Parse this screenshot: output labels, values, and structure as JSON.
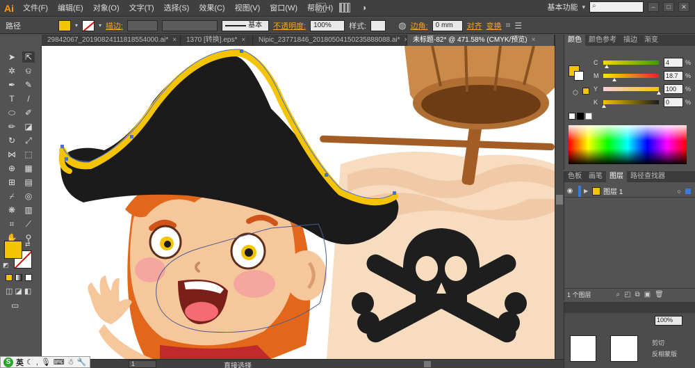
{
  "app": {
    "logo": "Ai"
  },
  "menu": [
    "文件(F)",
    "编辑(E)",
    "对象(O)",
    "文字(T)",
    "选择(S)",
    "效果(C)",
    "视图(V)",
    "窗口(W)",
    "帮助(H)"
  ],
  "menubar_right": {
    "workspace": "基本功能",
    "search_placeholder": ""
  },
  "control": {
    "selection_type": "路径",
    "fill_color": "#f5c400",
    "stroke_label": "描边:",
    "stroke_style": "基本",
    "opacity_label": "不透明度:",
    "opacity_value": "100%",
    "style_label": "样式:",
    "corner_label": "边角:",
    "corner_value": "0 mm",
    "align_label": "对齐",
    "transform_label": "变换"
  },
  "tabs": [
    {
      "label": "29842067_20190824111818554000.ai*",
      "active": false
    },
    {
      "label": "1370 [转换].eps*",
      "active": false
    },
    {
      "label": "Nipic_23771846_20180504150235888088.ai*",
      "active": false
    },
    {
      "label": "未标题-82* @ 471.58% (CMYK/预览)",
      "active": true
    }
  ],
  "color_panel": {
    "tabs": [
      "颜色",
      "颜色参考",
      "描边",
      "渐变"
    ],
    "channels": [
      {
        "label": "C",
        "value": "4",
        "level": 0.04
      },
      {
        "label": "M",
        "value": "18.7",
        "level": 0.187
      },
      {
        "label": "Y",
        "value": "100",
        "level": 1.0
      },
      {
        "label": "K",
        "value": "0",
        "level": 0.0
      }
    ],
    "pct": "%"
  },
  "layers_panel": {
    "tabs": [
      "色板",
      "画笔",
      "图层",
      "路径查找器"
    ],
    "layers": [
      {
        "name": "图层 1"
      }
    ],
    "footer_count": "1 个图层"
  },
  "bottom_panel": {
    "value": "100%",
    "items": [
      "剪切",
      "反相蒙版"
    ]
  },
  "statusbar": {
    "tool_name": "直接选择",
    "zoom": "",
    "page": "1"
  },
  "ime": {
    "mode": "英"
  },
  "colors": {
    "accent": "#f5c400",
    "hat": "#1b1b1b",
    "skin": "#f7c79c",
    "hair": "#e2671a"
  }
}
